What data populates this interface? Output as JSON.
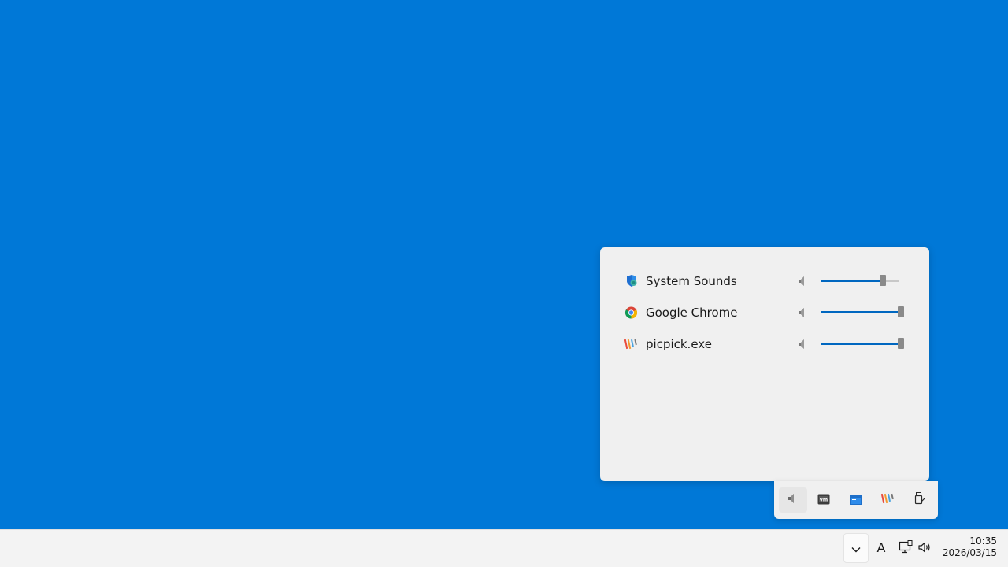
{
  "mixer": {
    "apps": [
      {
        "name": "System Sounds",
        "icon": "system-sounds-icon",
        "volume": 0.79
      },
      {
        "name": "Google Chrome",
        "icon": "chrome-icon",
        "volume": 1.0
      },
      {
        "name": "picpick.exe",
        "icon": "picpick-icon",
        "volume": 1.0
      }
    ]
  },
  "tray_overflow": {
    "icons": [
      "volume-icon",
      "vmware-icon",
      "app-window-icon",
      "picpick-icon",
      "usb-drive-icon"
    ],
    "active_index": 0
  },
  "taskbar": {
    "ime_label": "A",
    "clock": {
      "time": "10:35",
      "date": "2026/03/15"
    }
  },
  "colors": {
    "desktop": "#0078d7",
    "accent": "#0067c0",
    "panel": "#f0f0f0",
    "taskbar": "#f3f3f3"
  }
}
